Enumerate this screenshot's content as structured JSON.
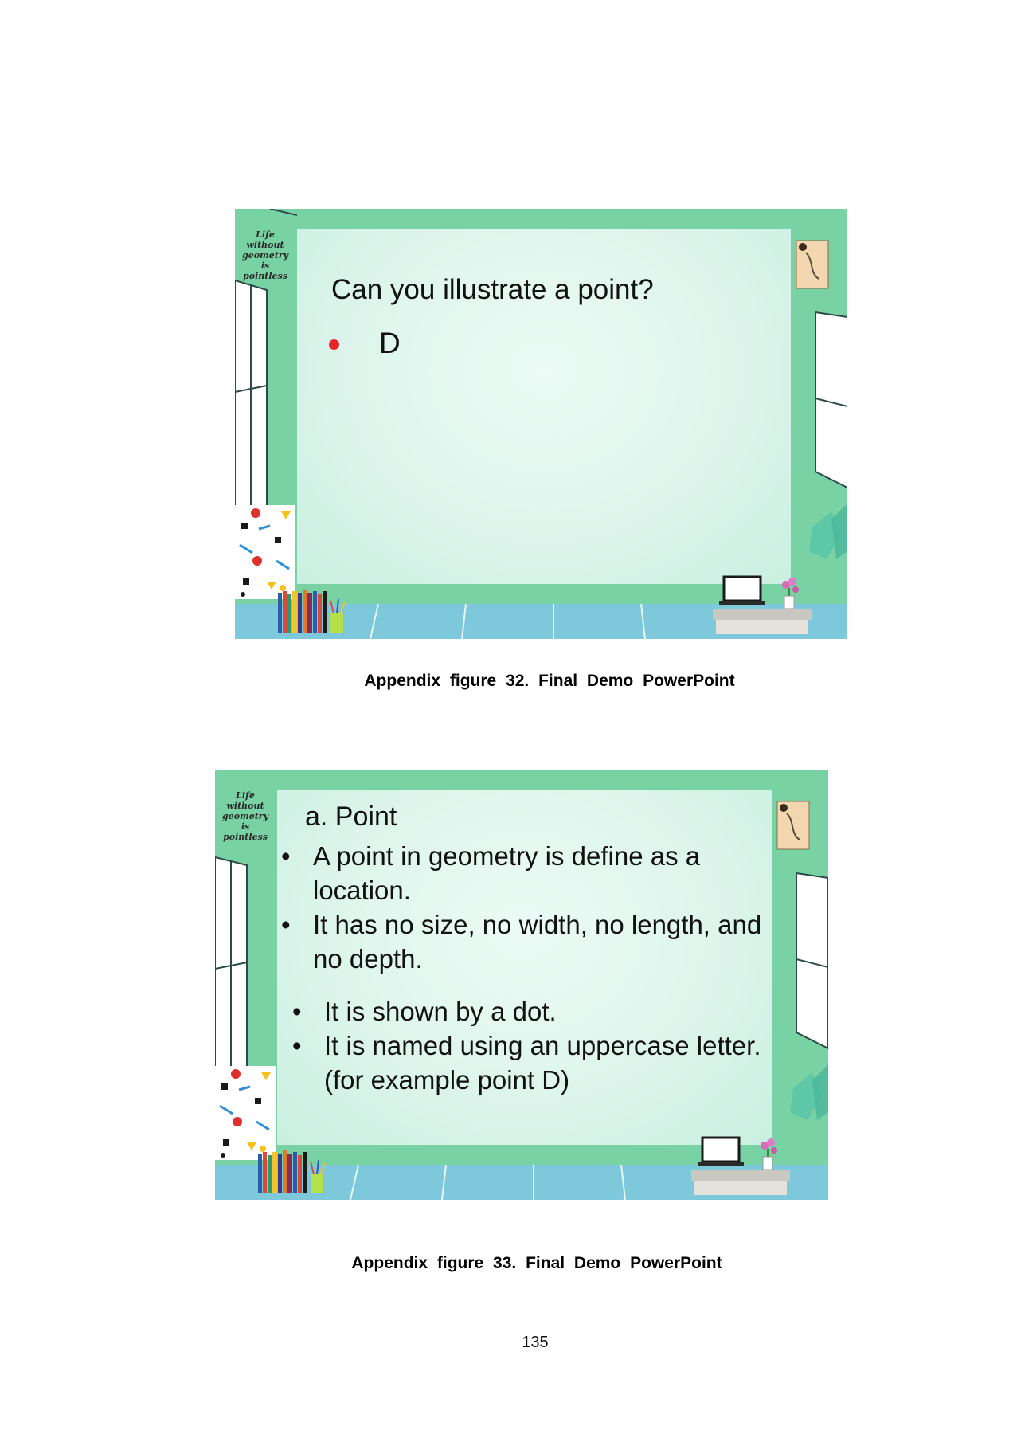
{
  "slides": [
    {
      "poster": [
        "Life",
        "without",
        "geometry",
        "is",
        "pointless"
      ],
      "title": "Can you illustrate a point?",
      "point_label": "D"
    },
    {
      "poster": [
        "Life",
        "without",
        "geometry",
        "is",
        "pointless"
      ],
      "title": "a. Point",
      "bullets": [
        {
          "mark": "•",
          "text": "A point in geometry is define as  a location."
        },
        {
          "mark": "•",
          "text": "It has no size, no width, no length, and no depth."
        },
        {
          "mark": "•",
          "text": "It is shown by a dot."
        },
        {
          "mark": "•",
          "text": "It is named using an uppercase letter. (for example point D)"
        }
      ]
    }
  ],
  "captions": [
    "Appendix figure 32. Final Demo PowerPoint",
    "Appendix figure 33. Final Demo PowerPoint"
  ],
  "page_number": "135",
  "colors": {
    "wall": "#78d2a4",
    "board": "#ddf5ec",
    "floor": "#7ec8dc",
    "point_dot": "#e8252b"
  }
}
